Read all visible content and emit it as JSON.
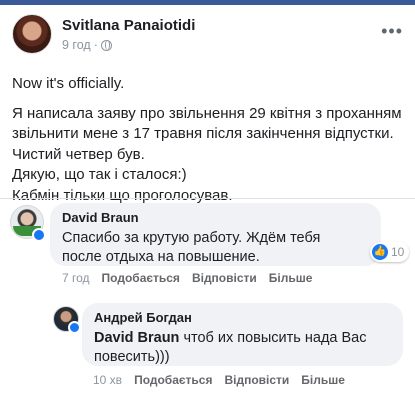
{
  "post": {
    "author": "Svitlana Panaiotidi",
    "time": "9 год",
    "separator": "·",
    "lines": [
      "Now it's officially.",
      "Я написала заяву про звільнення 29 квітня з проханням",
      "звільнити мене з 17 травня після закінчення відпустки.",
      "Чистий четвер був.",
      "Дякую, що так і сталося:)",
      "Кабмін тільки що проголосував."
    ]
  },
  "comments": [
    {
      "author": "David Braun",
      "text_line1": "Спасибо за крутую работу. Ждём тебя",
      "text_line2": "после отдыха на повышение.",
      "reaction_count": "10",
      "time": "7 год",
      "like_label": "Подобається",
      "reply_label": "Відповісти",
      "more_label": "Більше"
    },
    {
      "author": "Андрей Богдан",
      "mention": "David Braun",
      "text_line1": "чтоб их повысить нада Вас",
      "text_line2": "повесить)))",
      "time": "10 хв",
      "like_label": "Подобається",
      "reply_label": "Відповісти",
      "more_label": "Більше"
    }
  ],
  "icons": {
    "globe": "globe-icon",
    "more": "more-options-icon",
    "like": "like-reaction-icon",
    "verified": "badge-icon"
  },
  "colors": {
    "accent": "#1877f2",
    "topbar": "#3b5a9a",
    "bubble": "#f0f2f5",
    "meta_text": "#8d949e"
  }
}
